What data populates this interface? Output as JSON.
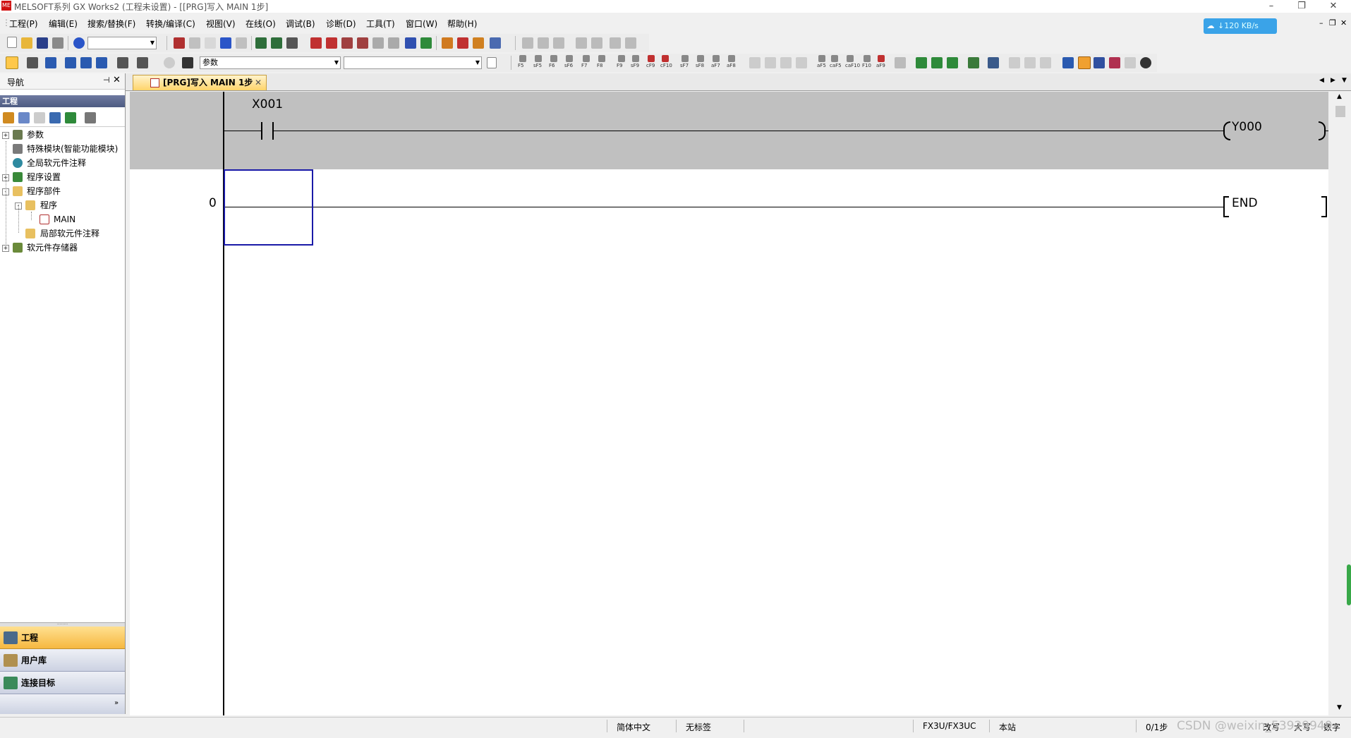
{
  "window": {
    "title": "MELSOFT系列 GX Works2 (工程未设置) - [[PRG]写入 MAIN 1步]"
  },
  "menu": [
    "工程(P)",
    "编辑(E)",
    "搜索/替换(F)",
    "转换/编译(C)",
    "视图(V)",
    "在线(O)",
    "调试(B)",
    "诊断(D)",
    "工具(T)",
    "窗口(W)",
    "帮助(H)"
  ],
  "network_badge": "↓120 KB/s",
  "toolbar": {
    "combo_param": "参数"
  },
  "ladder_toolbar_keys": [
    "F5",
    "sF5",
    "F6",
    "sF6",
    "F7",
    "F8",
    "F9",
    "sF9",
    "cF9",
    "cF10",
    "sF7",
    "sF8",
    "aF7",
    "aF8",
    "aF5",
    "caF5",
    "caF10",
    "F10",
    "aF9"
  ],
  "navigation": {
    "title": "导航",
    "section": "工程",
    "tree": [
      {
        "label": "参数",
        "level": 0,
        "expander": "+"
      },
      {
        "label": "特殊模块(智能功能模块)",
        "level": 0,
        "expander": ""
      },
      {
        "label": "全局软元件注释",
        "level": 0,
        "expander": ""
      },
      {
        "label": "程序设置",
        "level": 0,
        "expander": "+"
      },
      {
        "label": "程序部件",
        "level": 0,
        "expander": "-"
      },
      {
        "label": "程序",
        "level": 1,
        "expander": "-"
      },
      {
        "label": "MAIN",
        "level": 2,
        "expander": ""
      },
      {
        "label": "局部软元件注释",
        "level": 1,
        "expander": ""
      },
      {
        "label": "软元件存储器",
        "level": 0,
        "expander": "+"
      }
    ],
    "tabs": [
      "工程",
      "用户库",
      "连接目标"
    ]
  },
  "document_tab": {
    "label": "[PRG]写入 MAIN 1步"
  },
  "ladder": {
    "rungs": [
      {
        "step": "",
        "contact": "X001",
        "coil": "Y000"
      },
      {
        "step": "0",
        "contact": "",
        "coil": "END"
      }
    ]
  },
  "status": {
    "language": "简体中文",
    "label": "无标签",
    "plc_type": "FX3U/FX3UC",
    "station": "本站",
    "steps": "0/1步",
    "mode": "改写",
    "caps": "大写",
    "num": "数字"
  },
  "watermark": "CSDN @weixin_53929940"
}
